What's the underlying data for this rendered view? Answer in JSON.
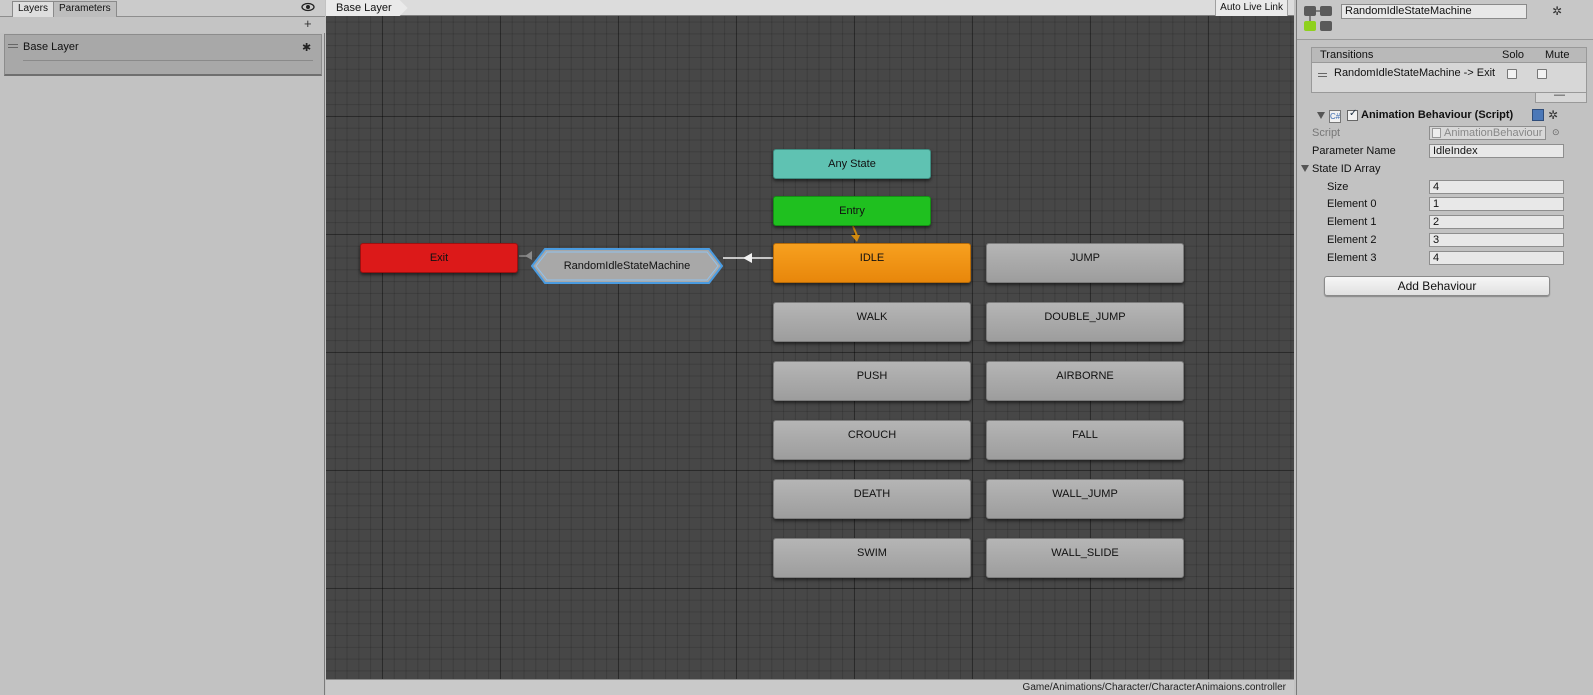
{
  "left_panel": {
    "tabs": [
      "Layers",
      "Parameters"
    ],
    "add_label": "+",
    "layer": {
      "name": "Base Layer",
      "gear": "✱"
    }
  },
  "graph": {
    "breadcrumb": "Base Layer",
    "live_link_label": "Auto Live Link",
    "asset_path": "Game/Animations/Character/CharacterAnimaions.controller",
    "nodes": {
      "any_state": "Any State",
      "entry": "Entry",
      "exit": "Exit",
      "idle": "IDLE",
      "state_machine": "RandomIdleStateMachine"
    },
    "states": [
      [
        "WALK",
        "DOUBLE_JUMP"
      ],
      [
        "PUSH",
        "AIRBORNE"
      ],
      [
        "CROUCH",
        "FALL"
      ],
      [
        "DEATH",
        "WALL_JUMP"
      ],
      [
        "SWIM",
        "WALL_SLIDE"
      ]
    ],
    "jump_state": "JUMP",
    "colors": {
      "any_state": "#5fc2b2",
      "entry": "#1fc01f",
      "exit": "#dc1919",
      "default_state": "#f0920f",
      "selected_outline": "#4a9be0"
    }
  },
  "inspector": {
    "object_name": "RandomIdleStateMachine",
    "transitions": {
      "header": "Transitions",
      "solo_label": "Solo",
      "mute_label": "Mute",
      "rows": [
        {
          "label": "RandomIdleStateMachine -> Exit"
        }
      ],
      "remove_label": "—"
    },
    "behaviour": {
      "title": "Animation Behaviour (Script)",
      "script_label": "Script",
      "script_value": "AnimationBehaviour",
      "param_label": "Parameter Name",
      "param_value": "IdleIndex",
      "array_label": "State ID Array",
      "size_label": "Size",
      "size_value": "4",
      "elements": [
        {
          "label": "Element 0",
          "value": "1"
        },
        {
          "label": "Element 1",
          "value": "2"
        },
        {
          "label": "Element 2",
          "value": "3"
        },
        {
          "label": "Element 3",
          "value": "4"
        }
      ]
    },
    "add_behaviour_label": "Add Behaviour"
  }
}
